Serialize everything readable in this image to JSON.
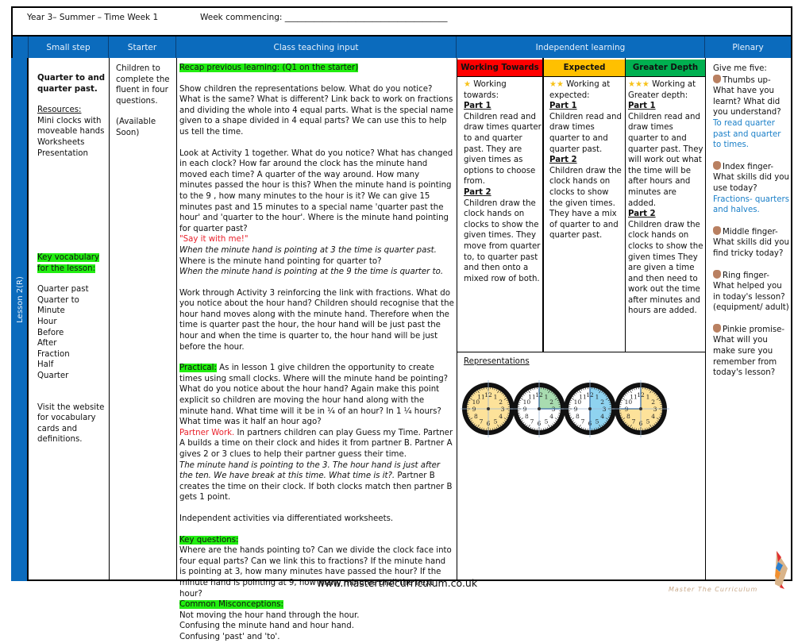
{
  "header": {
    "title": "Year 3– Summer – Time Week 1",
    "week_commencing": "Week commencing: _______________________________________"
  },
  "columns": {
    "small_step": "Small step",
    "starter": "Starter",
    "class_teaching": "Class teaching input",
    "independent": "Independent learning",
    "plenary": "Plenary"
  },
  "lesson_label": "Lesson 2(R)",
  "small_step": {
    "title": "Quarter to and quarter past.",
    "resources_label": "Resources:",
    "resources": [
      "Mini clocks with",
      "moveable hands",
      "Worksheets",
      "Presentation"
    ],
    "vocab_label": "Key vocabulary for the lesson:",
    "vocab": [
      "Quarter past",
      "Quarter to",
      "Minute",
      "Hour",
      "Before",
      "After",
      "Fraction",
      "Half",
      "Quarter"
    ],
    "visit": "Visit the website for vocabulary cards and definitions."
  },
  "starter": {
    "text": "Children to complete the fluent in four questions.",
    "availability": "(Available Soon)"
  },
  "teaching": {
    "recap": "Recap previous learning: (Q1 on the starter)",
    "p1": "Show children the representations below.  What do you notice? What is the same? What is different? Link back to work on fractions and dividing the whole into 4 equal parts. What is the special name given to a shape divided in 4 equal parts? We can use this to help us tell the time.",
    "p2": "Look at Activity 1 together.  What do you notice?  What has changed in each clock?  How far around the clock has the minute hand moved each time?  A quarter of the way around.  How many minutes passed the hour is this?  When the minute hand is pointing to the 9 , how many minutes to the hour is it? We can give 15 minutes past and 15 minutes to a special name  'quarter past the hour' and 'quarter to the hour'.  Where is the minute hand pointing for quarter past?",
    "say_it": "\"Say it with me!\"",
    "italic1": "When the minute hand is pointing at 3 the time is quarter past.",
    "q_quarter_to": "Where is the minute hand pointing for quarter to?",
    "italic2": "When the minute hand is pointing at the 9 the time is quarter to.",
    "p3": "Work through Activity 3 reinforcing the link with fractions.  What do you notice about the hour hand? Children should recognise that the hour hand moves along with the minute hand. Therefore when the time is quarter past the hour, the hour hand will be just past the hour and when the time is quarter to, the hour hand will be just before the hour.",
    "practical_label": "Practical:",
    "practical": " As in lesson 1 give children the opportunity to create times using small clocks. Where will the minute hand be pointing?  What do you notice about the hour hand? Again make this point explicit so children are moving the hour hand along with the minute hand.  What time will it be in ¼ of an hour? In 1 ¼ hours?  What time was it half an hour ago?",
    "partner_label": "Partner Work.",
    "partner": " In partners children can play Guess my Time.  Partner A builds a time on their clock and hides it from partner B. Partner A gives 2 or 3 clues to help their partner guess their time.",
    "partner_italic": "The minute hand is pointing to the 3.   The hour hand is just after the ten. We have break  at this time. What time is it?.",
    "partner_end": "  Partner B creates the time on their clock. If both clocks match then partner B gets 1 point.",
    "independent_note": "Independent activities via differentiated worksheets.",
    "key_q_label": "Key questions:",
    "key_q": "Where are the hands pointing to? Can we divide the clock face into four equal parts? Can we link this to fractions? If the minute hand is pointing at 3, how many minutes have passed the hour?  If the minute hand is pointing at 9, how many minutes until the next hour?",
    "misconceptions_label": "Common Misconceptions:",
    "misconceptions": [
      "Not moving the hour hand through the hour.",
      "Confusing the minute hand  and hour hand.",
      "Confusing 'past' and 'to'."
    ]
  },
  "independent": {
    "levels": [
      {
        "label": "Working Towards",
        "color": "#ff0000",
        "stars": "★",
        "intro": " Working towards:",
        "part1_label": "Part 1",
        "part1": "Children read and draw times quarter to and quarter past.  They are given times as options to choose from.",
        "part2_label": "Part 2",
        "part2": "Children draw the clock hands on clocks to show the given times. They move from quarter to,  to quarter past and then onto a mixed row of both."
      },
      {
        "label": "Expected",
        "color": "#ffc000",
        "stars": "★★",
        "intro": " Working at expected:",
        "part1_label": "Part 1",
        "part1": "Children read and draw times quarter to and quarter past.",
        "part2_label": "Part 2",
        "part2": "Children draw the clock hands on clocks to show the given times. They have a mix of quarter to and quarter past."
      },
      {
        "label": "Greater Depth",
        "color": "#00b050",
        "stars": "★★★",
        "intro": " Working at Greater depth:",
        "part1_label": "Part 1",
        "part1": "Children read and draw times quarter to and quarter past.  They will work out what the time will be after hours and minutes are added.",
        "part2_label": "Part 2",
        "part2": "Children draw the clock hands on clocks to show the given times  They are given a time and then need to work out the time after minutes and hours are added."
      }
    ],
    "representations_label": "Representations",
    "clocks": [
      {
        "shaded_fraction": 1.0,
        "color": "#fde29a"
      },
      {
        "shaded_fraction": 0.25,
        "color": "#a8dcb0"
      },
      {
        "shaded_fraction": 0.5,
        "color": "#8fd3f0"
      },
      {
        "shaded_fraction": 0.75,
        "color": "#fde29a"
      }
    ]
  },
  "plenary": {
    "intro": "Give me five:",
    "items": [
      {
        "label": "Thumbs up-",
        "q": "What have you learnt? What did you understand?",
        "answer": "To read quarter past and quarter to times."
      },
      {
        "label": "Index finger-",
        "q": "What skills did you use today?",
        "answer": "Fractions- quarters and halves."
      },
      {
        "label": "Middle finger-",
        "q": "What skills did you find tricky today?",
        "answer": ""
      },
      {
        "label": "Ring finger-",
        "q": "What helped you in today's lesson? (equipment/ adult)",
        "answer": ""
      },
      {
        "label": "Pinkie promise-",
        "q": "What will you make sure you remember from today's lesson?",
        "answer": ""
      }
    ]
  },
  "footer": {
    "url": "www.masterthecurriculum.co.uk",
    "brand": "Master The Curriculum"
  }
}
